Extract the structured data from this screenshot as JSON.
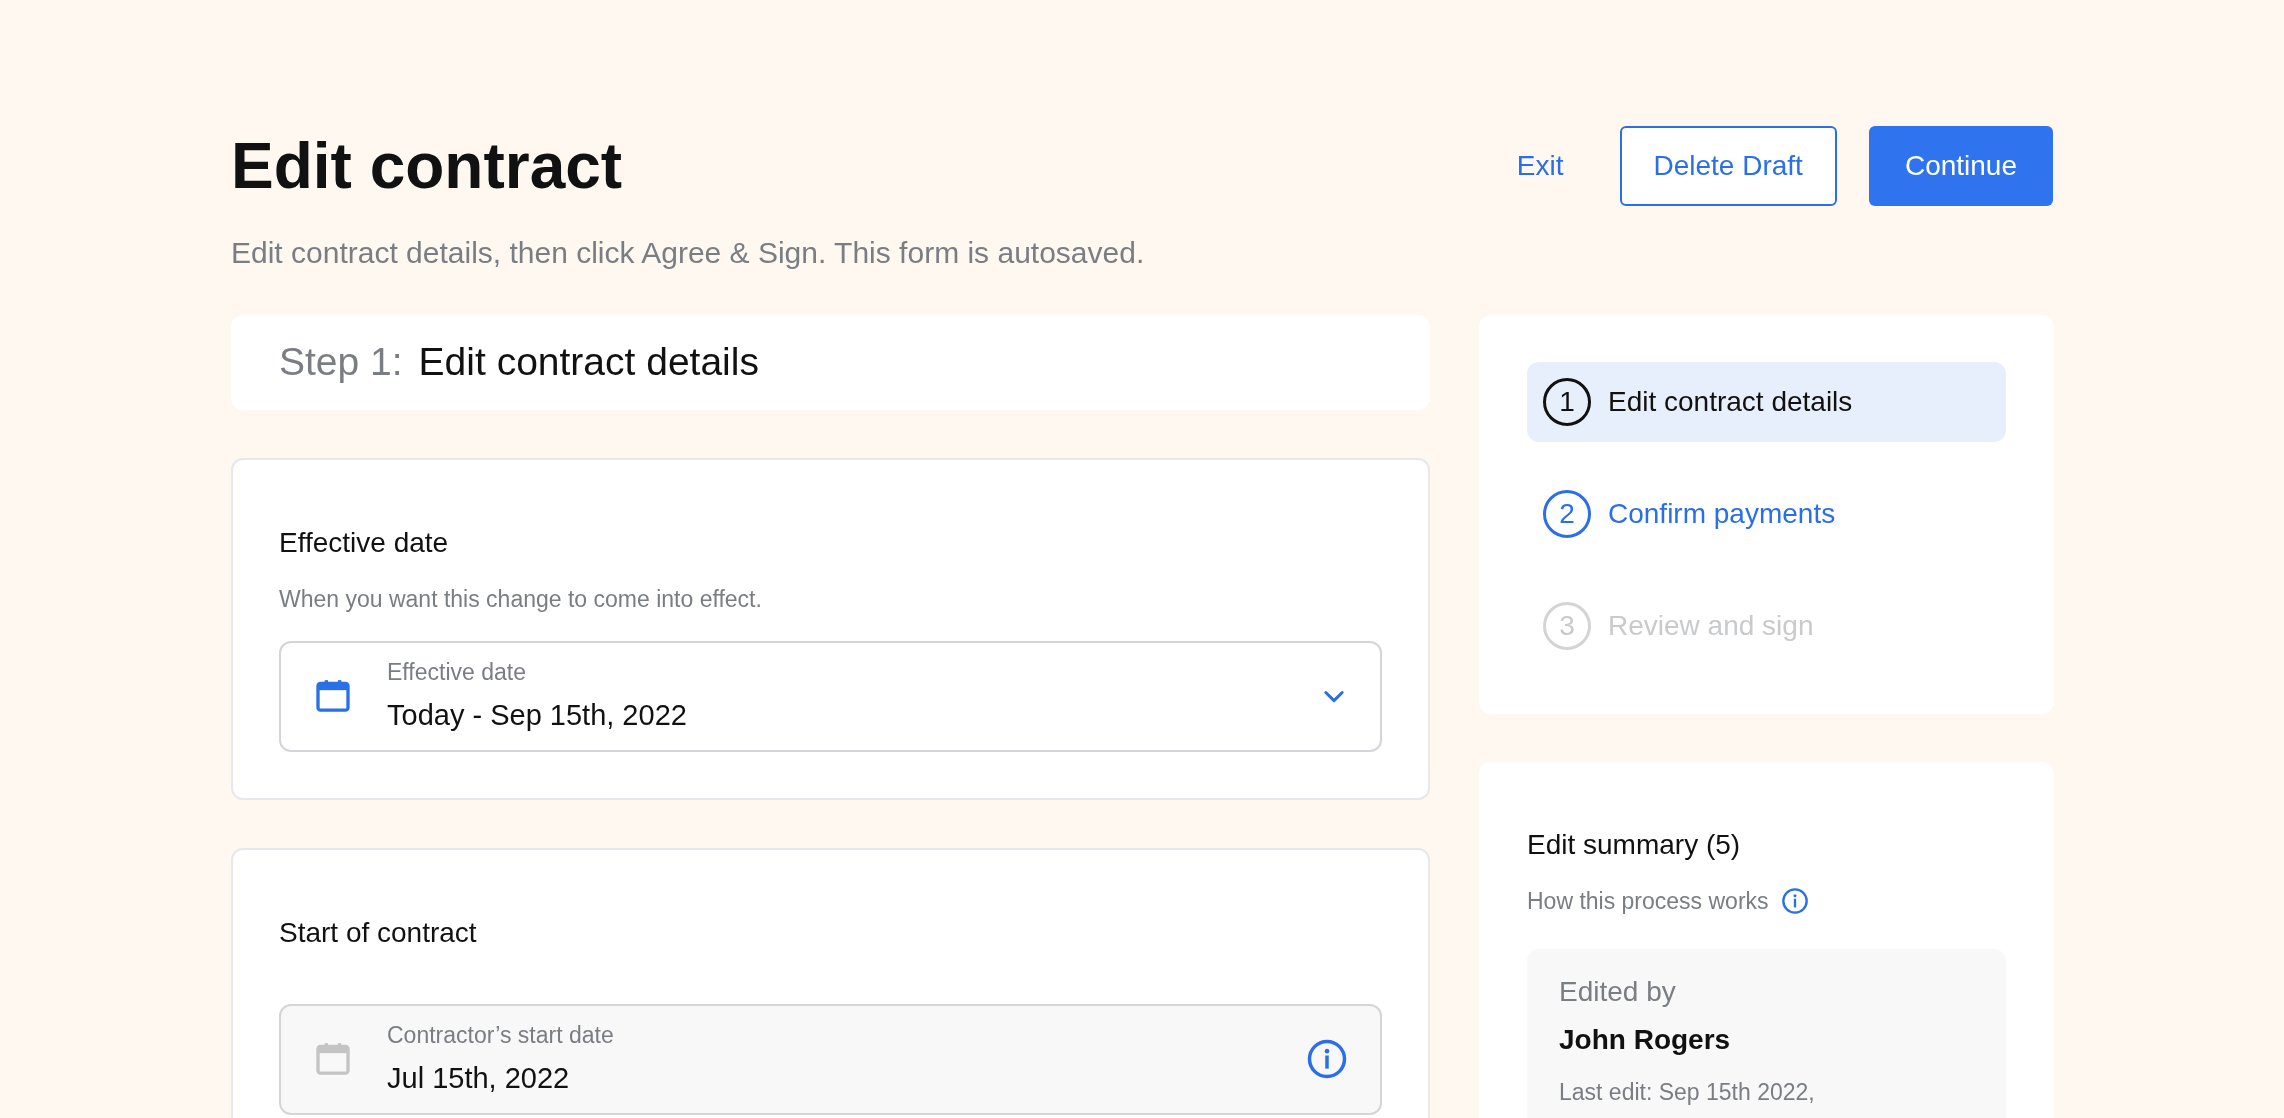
{
  "header": {
    "title": "Edit contract",
    "subtitle": "Edit contract details, then click Agree & Sign. This form is autosaved.",
    "actions": [
      {
        "label": "Exit",
        "kind": "link"
      },
      {
        "label": "Delete Draft",
        "kind": "outline"
      },
      {
        "label": "Continue",
        "kind": "primary"
      }
    ]
  },
  "step_banner": {
    "prefix": "Step 1:",
    "title": "Edit contract details"
  },
  "sections": [
    {
      "heading": "Effective date",
      "description": "When you want this change to come into effect.",
      "field": {
        "label": "Effective date",
        "value": "Today - Sep 15th, 2022",
        "disabled": false,
        "kind": "dropdown"
      }
    },
    {
      "heading": "Start of contract",
      "field": {
        "label": "Contractor’s start date",
        "value": "Jul 15th, 2022",
        "disabled": true,
        "kind": "info"
      }
    }
  ],
  "steps": [
    {
      "number": "1",
      "label": "Edit contract details",
      "selected": true,
      "disabled": false
    },
    {
      "number": "2",
      "label": "Confirm payments",
      "selected": false,
      "disabled": false
    },
    {
      "number": "3",
      "label": "Review and sign",
      "selected": false,
      "disabled": true
    }
  ],
  "summary": {
    "title": "Edit summary (5)",
    "help": "How this process works",
    "edited_by_label": "Edited by",
    "editor": "John Rogers",
    "last_edit": "Last edit: Sep 15th 2022,"
  }
}
